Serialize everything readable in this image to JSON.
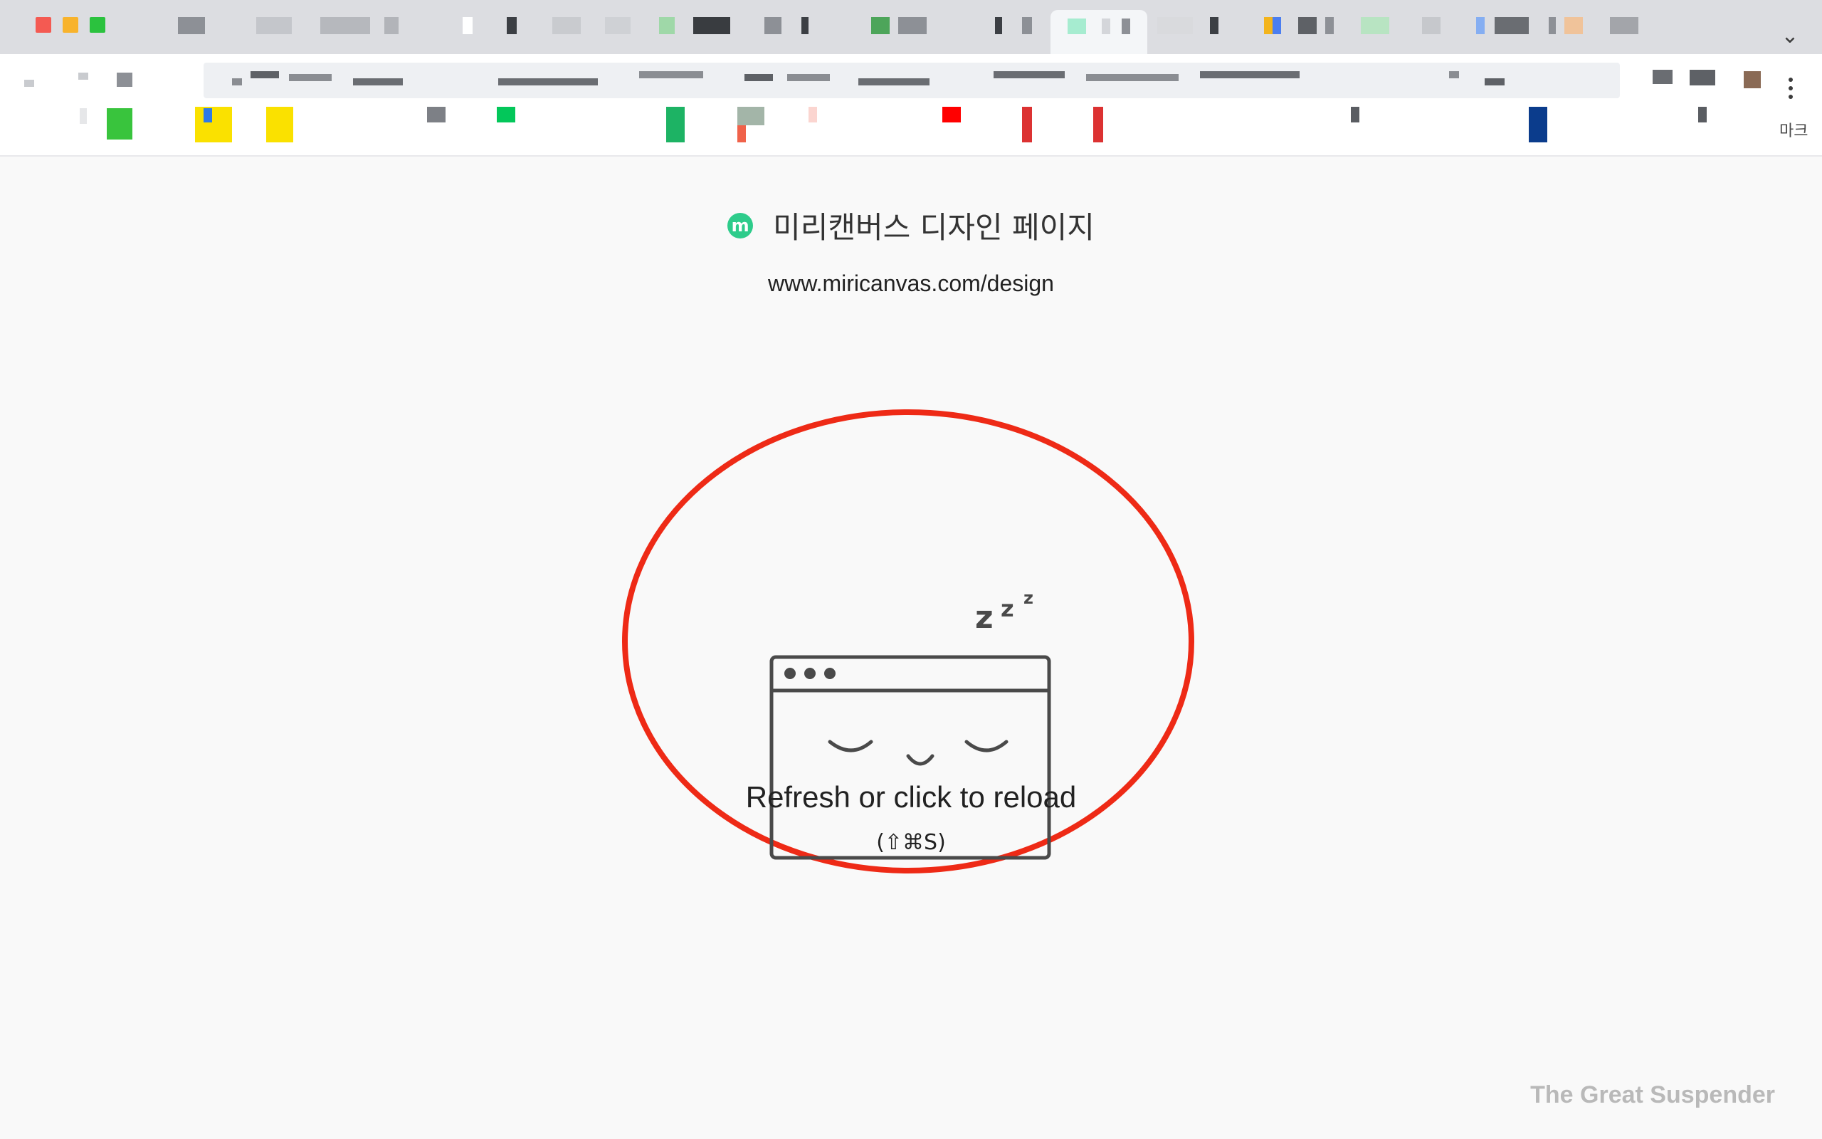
{
  "browser": {
    "bookmarks_more_label": "마크"
  },
  "page": {
    "favicon_letter": "m",
    "title": "미리캔버스 디자인 페이지",
    "url": "www.miricanvas.com/design",
    "reload_label": "Refresh or click to reload",
    "shortcut_label": "(⇧⌘S)",
    "brand_label": "The Great Suspender",
    "illustration_zzz": [
      "z",
      "z",
      "z"
    ]
  },
  "colors": {
    "accent_circle": "#ee2a16",
    "favicon": "#2ecc8b",
    "illustration_stroke": "#4a4a4a"
  }
}
